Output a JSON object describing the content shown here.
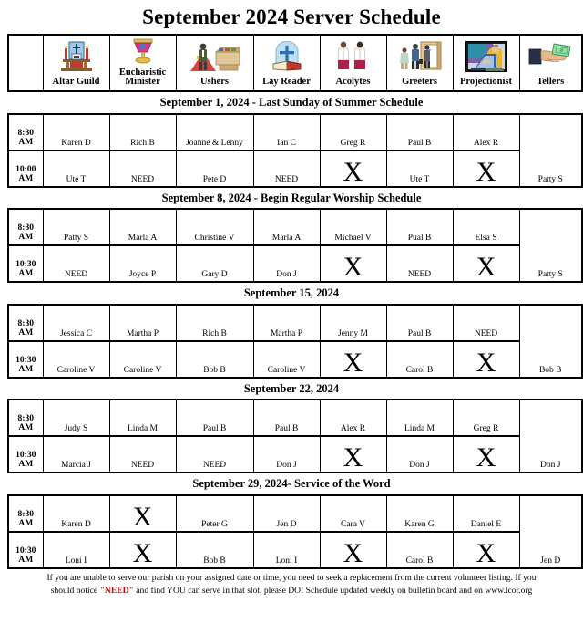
{
  "title": "September 2024 Server Schedule",
  "columns": [
    {
      "key": "time",
      "label": "",
      "icon": ""
    },
    {
      "key": "altar_guild",
      "label": "Altar Guild",
      "icon": "altar-icon"
    },
    {
      "key": "eucharistic",
      "label": "Eucharistic\nMinister",
      "icon": "chalice-icon"
    },
    {
      "key": "ushers",
      "label": "Ushers",
      "icon": "usher-icon"
    },
    {
      "key": "lay_reader",
      "label": "Lay Reader",
      "icon": "stained-glass-bible-icon"
    },
    {
      "key": "acolytes",
      "label": "Acolytes",
      "icon": "acolytes-icon"
    },
    {
      "key": "greeters",
      "label": "Greeters",
      "icon": "greeters-doorway-icon"
    },
    {
      "key": "projectionist",
      "label": "Projectionist",
      "icon": "laptop-operator-icon"
    },
    {
      "key": "tellers",
      "label": "Tellers",
      "icon": "hand-money-icon"
    }
  ],
  "blocks": [
    {
      "caption": "September 1, 2024 - Last Sunday of Summer Schedule",
      "teller": "Patty S",
      "rows": [
        {
          "time": "8:30\nAM",
          "cells": [
            "Karen D",
            "Rich B",
            "Joanne & Lenny",
            "Ian C",
            "Greg R",
            "Paul B",
            "Alex R"
          ]
        },
        {
          "time": "10:00\nAM",
          "cells": [
            "Ute T",
            "NEED",
            "Pete D",
            "NEED",
            "X",
            "Ute T",
            "X"
          ]
        }
      ]
    },
    {
      "caption": "September 8, 2024 - Begin Regular Worship Schedule",
      "teller": "Patty S",
      "rows": [
        {
          "time": "8:30\nAM",
          "cells": [
            "Patty S",
            "Marla A",
            "Christine V",
            "Marla A",
            "Michael V",
            "Pual B",
            "Elsa S"
          ]
        },
        {
          "time": "10:30\nAM",
          "cells": [
            "NEED",
            "Joyce P",
            "Gary D",
            "Don J",
            "X",
            "NEED",
            "X"
          ]
        }
      ]
    },
    {
      "caption": "September 15, 2024",
      "teller": "Bob B",
      "rows": [
        {
          "time": "8:30\nAM",
          "cells": [
            "Jessica C",
            "Martha P",
            "Rich B",
            "Martha P",
            "Jenny M",
            "Paul B",
            "NEED"
          ]
        },
        {
          "time": "10:30\nAM",
          "cells": [
            "Caroline V",
            "Caroline V",
            "Bob B",
            "Caroline V",
            "X",
            "Carol B",
            "X"
          ]
        }
      ]
    },
    {
      "caption": "September 22, 2024",
      "teller": "Don J",
      "rows": [
        {
          "time": "8:30\nAM",
          "cells": [
            "Judy S",
            "Linda M",
            "Paul B",
            "Paul B",
            "Alex R",
            "Linda M",
            "Greg R"
          ]
        },
        {
          "time": "10:30\nAM",
          "cells": [
            "Marcia J",
            "NEED",
            "NEED",
            "Don J",
            "X",
            "Don J",
            "X"
          ]
        }
      ]
    },
    {
      "caption": "September 29, 2024- Service of the Word",
      "teller": "Jen D",
      "rows": [
        {
          "time": "8:30\nAM",
          "cells": [
            "Karen D",
            "X",
            "Peter G",
            "Jen D",
            "Cara V",
            "Karen G",
            "Daniel E"
          ]
        },
        {
          "time": "10:30\nAM",
          "cells": [
            "Loni I",
            "X",
            "Bob B",
            "Loni I",
            "X",
            "Carol B",
            "X"
          ]
        }
      ]
    }
  ],
  "footer": {
    "line1_a": "If you are unable to serve our parish on your assigned date or time, you need to seek a replacement from the current volunteer listing.  If you",
    "line2_a": "should notice ",
    "line2_need": "\"NEED\"",
    "line2_b": " and find YOU can serve in that slot, please DO!  Schedule updated weekly on bulletin board and on www.lcor.org"
  },
  "colors": {
    "need_red": "#cc0000",
    "border": "#000000",
    "background": "#ffffff"
  }
}
